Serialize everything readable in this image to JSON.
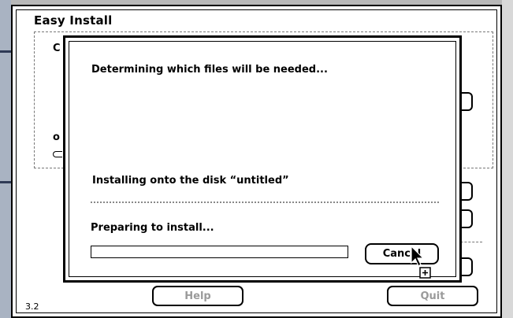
{
  "window": {
    "title": "Easy Install",
    "version": "3.2",
    "peek_letter_top": "C",
    "peek_letter_mid": "o"
  },
  "buttons": {
    "help": "Help",
    "quit": "Quit"
  },
  "dialog": {
    "status_line": "Determining which files will be needed...",
    "target_line": "Installing onto the disk “untitled”",
    "phase_line": "Preparing to install...",
    "progress": 0,
    "cancel_label": "Cancel"
  },
  "cursor": {
    "icon": "arrow-copy-cursor-icon"
  }
}
